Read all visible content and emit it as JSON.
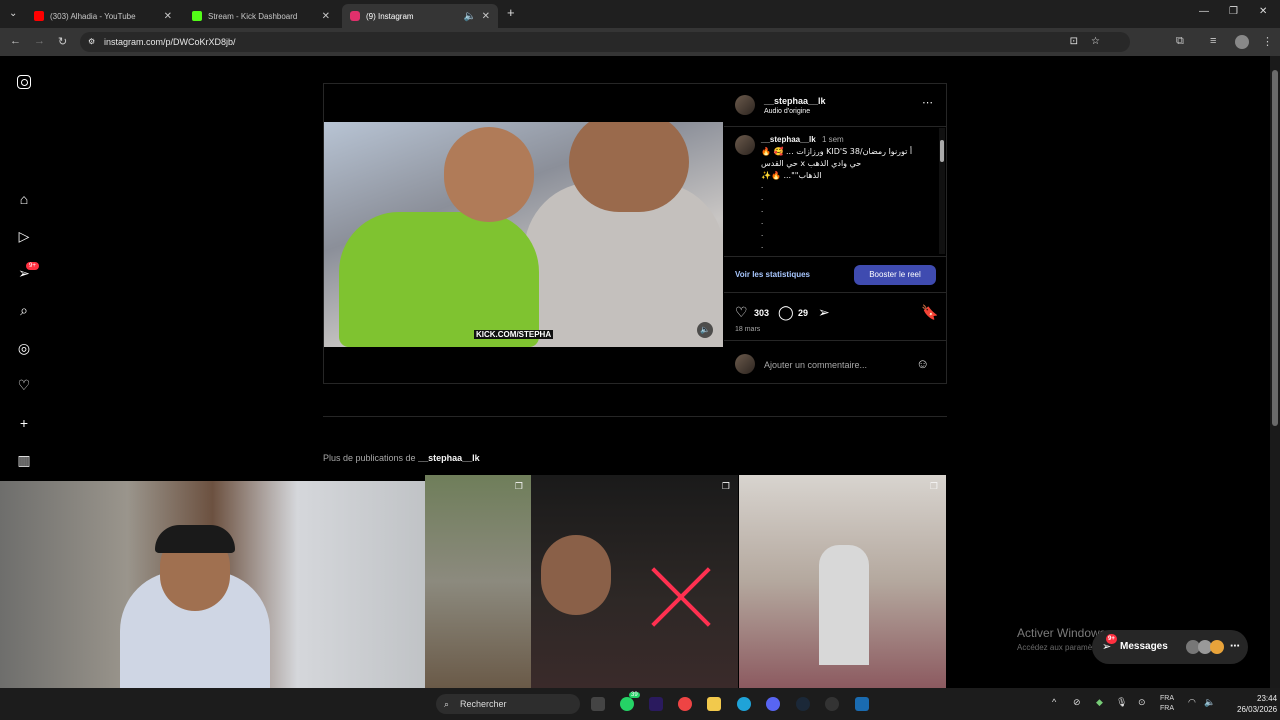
{
  "browser": {
    "tabs": [
      {
        "title": "(303) Alhadia - YouTube",
        "color": "#ff0000"
      },
      {
        "title": "Stream - Kick Dashboard",
        "color": "#53fc18"
      },
      {
        "title": "(9) Instagram",
        "color": "#e1306c"
      }
    ],
    "url": "instagram.com/p/DWCoKrXD8jb/"
  },
  "sidebar": {
    "badge": "9+"
  },
  "post": {
    "author": "__stephaa__lk",
    "audio": "Audio d'origine",
    "time_ago": "1 sem",
    "caption_lines": [
      "🔥 🥰 ... ورزازات KID'S 38/أ تورنوا رمضان",
      "حي القدس  x حي وادي الذهب",
      "✨🔥 ...\"\"الذهاب"
    ],
    "video_overlay_text": "KICK.COM/STEPHA",
    "stats_link": "Voir les statistiques",
    "boost_button": "Booster le reel",
    "likes": "303",
    "comments": "29",
    "date": "18 mars",
    "comment_placeholder": "Ajouter un commentaire..."
  },
  "more": {
    "prefix": "Plus de publications de",
    "handle": "__stephaa__lk"
  },
  "overlay": {
    "activate_title": "Activer Windows",
    "activate_sub": "Accédez aux paramètres",
    "messages": "Messages",
    "messages_badge": "9+"
  },
  "taskbar": {
    "search_placeholder": "Rechercher",
    "lang1": "FRA",
    "lang2": "FRA",
    "time": "23:44",
    "date": "26/03/2026",
    "notif": "39"
  }
}
